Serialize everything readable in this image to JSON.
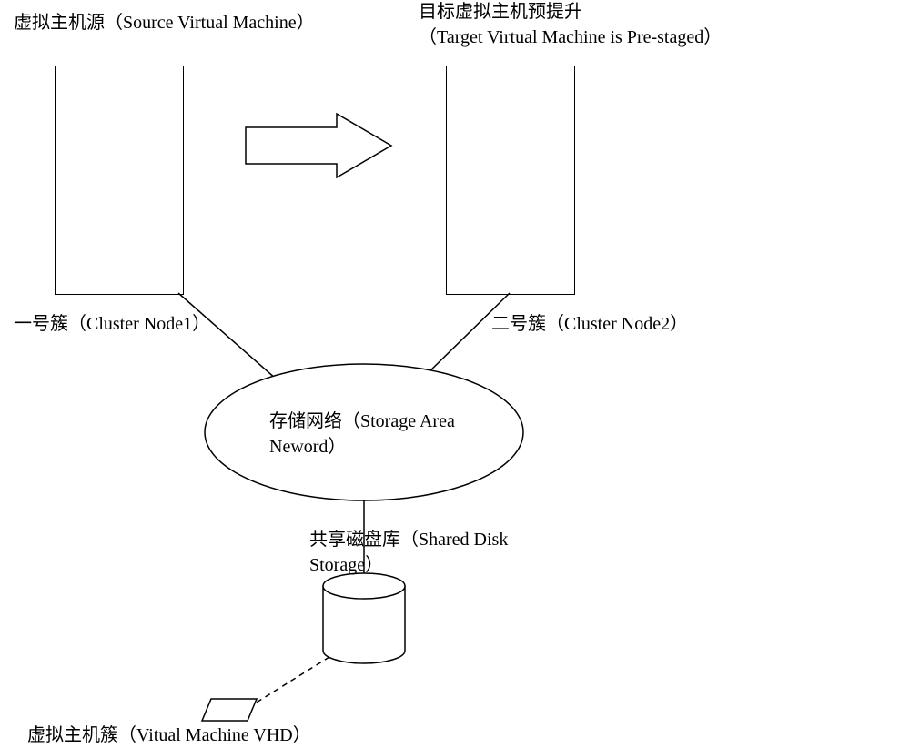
{
  "labels": {
    "source_vm": "虚拟主机源（Source Virtual Machine）",
    "target_vm_line1": "目标虚拟主机预提升",
    "target_vm_line2": "（Target Virtual Machine is Pre-staged）",
    "cluster1": "一号簇（Cluster Node1）",
    "cluster2": "二号簇（Cluster Node2）",
    "san_line1": "存储网络（Storage Area",
    "san_line2": "Neword）",
    "shared_disk_line1": "共享磁盘库（Shared Disk",
    "shared_disk_line2": "Storage）",
    "vm_cluster": "虚拟主机簇（Vitual Machine VHD）"
  }
}
